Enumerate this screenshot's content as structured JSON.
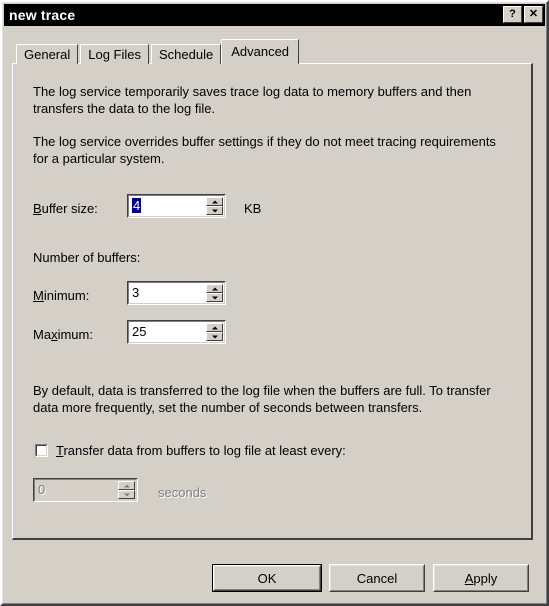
{
  "window": {
    "title": "new trace",
    "help_button": "?",
    "close_button": "✕"
  },
  "tabs": [
    {
      "label": "General",
      "selected": false
    },
    {
      "label": "Log Files",
      "selected": false
    },
    {
      "label": "Schedule",
      "selected": false
    },
    {
      "label": "Advanced",
      "selected": true
    }
  ],
  "advanced": {
    "paragraph1": "The log service temporarily saves trace log data to memory buffers and then transfers the data to the log file.",
    "paragraph2": "The log service overrides buffer settings if they do not meet tracing requirements for a particular system.",
    "buffer_size": {
      "label_prefix": "",
      "label_accel": "B",
      "label_suffix": "uffer size:",
      "value": "4",
      "unit": "KB"
    },
    "number_of_buffers_label": "Number of buffers:",
    "minimum": {
      "label_accel": "M",
      "label_suffix": "inimum:",
      "value": "3"
    },
    "maximum": {
      "label_prefix": "Ma",
      "label_accel": "x",
      "label_suffix": "imum:",
      "value": "25"
    },
    "paragraph3": "By default, data is transferred to the log file when the buffers are full. To transfer data more frequently, set the number of seconds between transfers.",
    "transfer_checkbox": {
      "label_accel": "T",
      "label_suffix": "ransfer data from buffers to log file at least every:",
      "checked": false
    },
    "transfer_seconds": {
      "value": "0",
      "unit": "seconds",
      "enabled": false
    }
  },
  "buttons": {
    "ok": "OK",
    "cancel": "Cancel",
    "apply_accel": "A",
    "apply_suffix": "pply"
  }
}
